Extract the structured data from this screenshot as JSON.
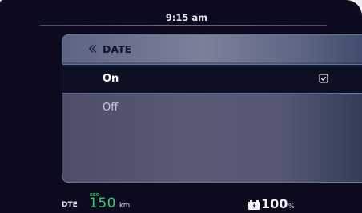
{
  "status_bar": {
    "time": "9:15 am"
  },
  "menu": {
    "title": "DATE",
    "back_icon": "double-chevron-left-icon",
    "options": [
      {
        "label": "On",
        "selected": true,
        "icon": "checkbox-checked-icon"
      },
      {
        "label": "Off",
        "selected": false
      }
    ]
  },
  "footer": {
    "dte_label": "DTE",
    "mode_label": "ECO",
    "range_value": "150",
    "range_unit": "km",
    "battery_icon": "battery-charging-icon",
    "battery_value": "100",
    "battery_unit": "%"
  },
  "colors": {
    "screen_bg": "#0b0a1f",
    "eco_green": "#2fcf6b",
    "selection_border": "#5e76b8"
  }
}
